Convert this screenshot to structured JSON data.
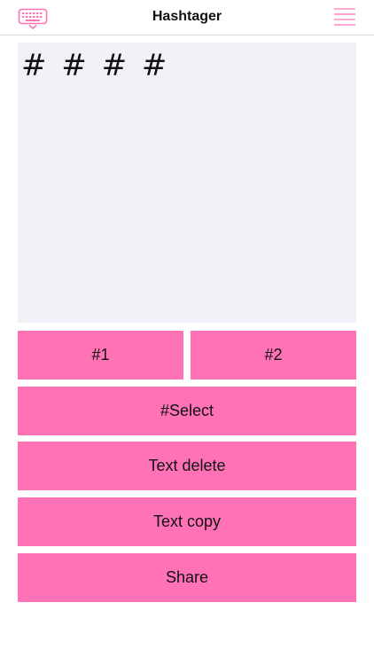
{
  "header": {
    "title": "Hashtager",
    "left_icon": "keyboard-icon",
    "right_icon": "menu-icon",
    "accent_color": "#ff72b6"
  },
  "editor": {
    "value": "# # # #"
  },
  "buttons": {
    "hash1": "#1",
    "hash2": "#2",
    "select": "#Select",
    "text_delete": "Text delete",
    "text_copy": "Text copy",
    "share": "Share"
  },
  "colors": {
    "button_bg": "#ff72b6",
    "editor_bg": "#f2f1f7",
    "text": "#111111"
  }
}
